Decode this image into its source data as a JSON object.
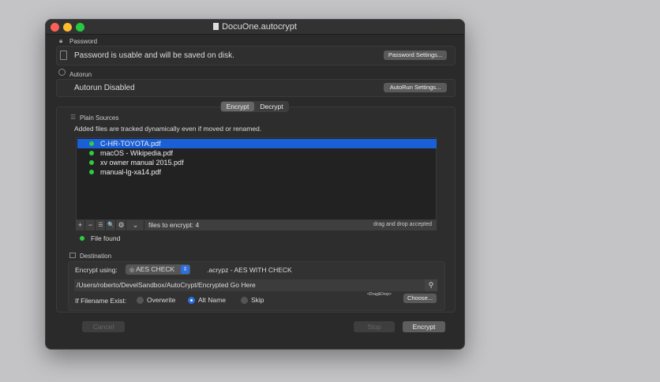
{
  "window": {
    "title": "DocuOne.autocrypt"
  },
  "password": {
    "section_label": "Password",
    "status": "Password is usable and will be saved on disk.",
    "settings_button": "Password Settings..."
  },
  "autorun": {
    "section_label": "Autorun",
    "status": "Autorun Disabled",
    "settings_button": "AutoRun Settings..."
  },
  "tabs": [
    {
      "label": "Encrypt",
      "selected": true
    },
    {
      "label": "Decrypt",
      "selected": false
    }
  ],
  "sources": {
    "section_label": "Plain Sources",
    "hint": "Added files are tracked dynamically  even if moved or renamed.",
    "files": [
      {
        "name": "C-HR-TOYOTA.pdf",
        "selected": true
      },
      {
        "name": "macOS - Wikipedia.pdf"
      },
      {
        "name": "xv owner manual 2015.pdf"
      },
      {
        "name": "manual-lg-xa14.pdf"
      }
    ],
    "toolbar": {
      "add": "+",
      "remove": "−",
      "list": "☰",
      "search": "🔍",
      "gear": "⚙",
      "dropdown": "⌄",
      "count_text": "files to encrypt: 4",
      "dnd_text": "drag and drop accepted"
    },
    "file_status": "File found"
  },
  "destination": {
    "section_label": "Destination",
    "encrypt_using_label": "Encrypt using:",
    "method": "AES CHECK",
    "method_desc": ".acrypz - AES WITH CHECK",
    "path": "/Users/roberto/DevelSandbox/AutoCrypt/Encrypted Go Here",
    "exist_label": "If Filename Exist:",
    "options": [
      "Overwrite",
      "Alt Name",
      "Skip"
    ],
    "selected_option": "Alt Name",
    "dragdrop_hint": "<Drag&Drop>",
    "choose_button": "Choose..."
  },
  "buttons": {
    "cancel": "Cancel",
    "stop": "Stop",
    "encrypt": "Encrypt"
  },
  "colors": {
    "selection": "#1a5fd6",
    "accent": "#2b6fe0",
    "status_green": "#2ecc40"
  }
}
